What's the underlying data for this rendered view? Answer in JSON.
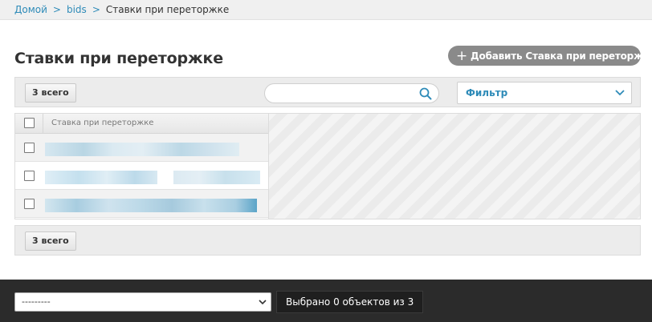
{
  "breadcrumbs": {
    "home": "Домой",
    "section": "bids",
    "current": "Ставки при переторжке",
    "separator": ">"
  },
  "page": {
    "title": "Ставки при переторжке",
    "add_button_label": "Добавить Ставка при переторжке",
    "add_button_icon": "plus-icon"
  },
  "toolbar_top": {
    "count_label": "3 всего",
    "search_value": "",
    "search_icon": "search-icon",
    "filter_label": "Фильтр",
    "filter_icon": "chevron-down-icon"
  },
  "table": {
    "columns": [
      "Ставка при переторжке"
    ],
    "rows": [
      {
        "value": "",
        "checked": false
      },
      {
        "value": "",
        "checked": false
      },
      {
        "value": "",
        "checked": false
      }
    ]
  },
  "toolbar_bottom": {
    "count_label": "3 всего"
  },
  "footer": {
    "action_select_value": "---------",
    "selected_text": "Выбрано 0 объектов из 3"
  },
  "colors": {
    "link": "#2e8bb8",
    "add_button_bg": "#8a8a8a",
    "footer_bg": "#2b2b2b"
  }
}
